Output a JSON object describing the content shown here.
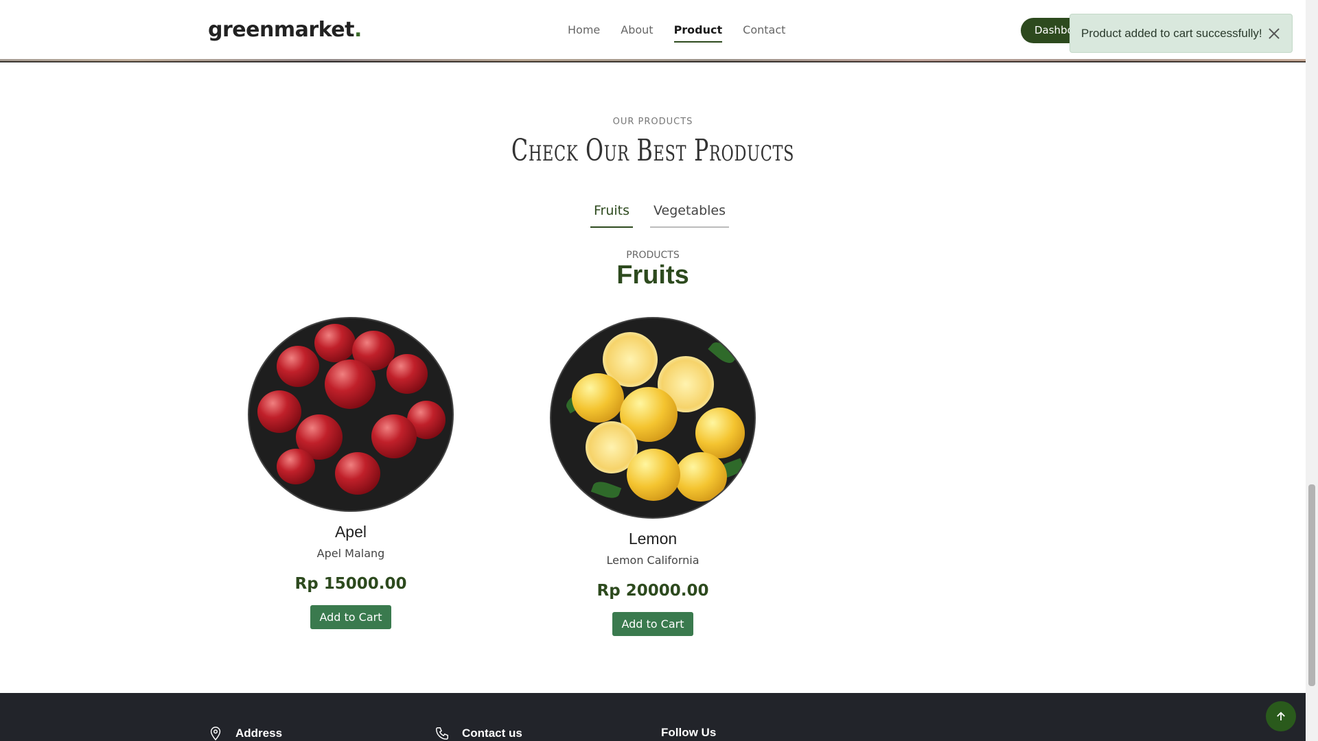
{
  "header": {
    "logo": "greenmarket",
    "logo_dot": ".",
    "nav": [
      "Home",
      "About",
      "Product",
      "Contact"
    ],
    "active_nav": "Product",
    "dashboard_label": "Dashboard"
  },
  "toast": {
    "message": "Product added to cart successfully!"
  },
  "section": {
    "eyebrow": "OUR PRODUCTS",
    "headline": "Check Our Best Products",
    "tabs": [
      "Fruits",
      "Vegetables"
    ],
    "active_tab": "Fruits",
    "sub_eyebrow": "PRODUCTS",
    "category_title": "Fruits"
  },
  "products": [
    {
      "name": "Apel",
      "description": "Apel Malang",
      "price": "Rp 15000.00",
      "button": "Add to Cart"
    },
    {
      "name": "Lemon",
      "description": "Lemon California",
      "price": "Rp 20000.00",
      "button": "Add to Cart"
    }
  ],
  "footer": {
    "address_label": "Address",
    "contact_label": "Contact us",
    "follow_label": "Follow Us"
  },
  "colors": {
    "brand": "#2d4a1e",
    "button": "#3a7a4e",
    "toast_bg": "#d9e8dd",
    "footer_bg": "#22242a"
  }
}
